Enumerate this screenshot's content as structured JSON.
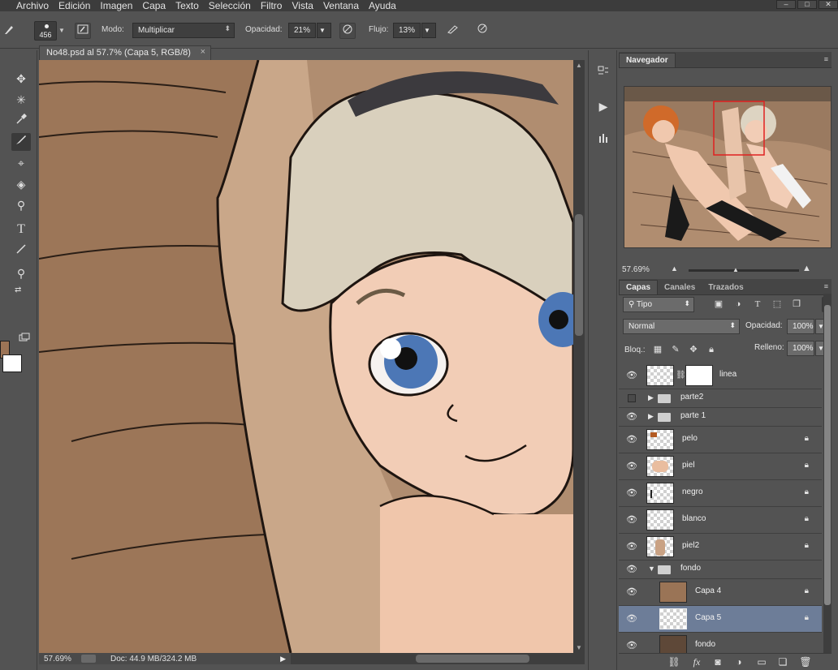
{
  "menubar": {
    "items": [
      "Archivo",
      "Edición",
      "Imagen",
      "Capa",
      "Texto",
      "Selección",
      "Filtro",
      "Vista",
      "Ventana",
      "Ayuda"
    ]
  },
  "options": {
    "brush_size": "456",
    "mode_label": "Modo:",
    "mode_value": "Multiplicar",
    "opacity_label": "Opacidad:",
    "opacity_value": "21%",
    "flow_label": "Flujo:",
    "flow_value": "13%"
  },
  "document": {
    "tab_title": "No48.psd al 57.7% (Capa 5, RGB/8)",
    "zoom": "57.69%",
    "doc_info": "Doc: 44.9 MB/324.2 MB"
  },
  "colors": {
    "foreground": "#9c7456",
    "background": "#ffffff",
    "selected_layer": "#6d7d98"
  },
  "navigator": {
    "title": "Navegador",
    "zoom": "57.69%"
  },
  "layers_panel": {
    "tabs": [
      "Capas",
      "Canales",
      "Trazados"
    ],
    "filter_value": "Tipo",
    "blend_mode": "Normal",
    "opacity_label": "Opacidad:",
    "opacity_value": "100%",
    "lock_label": "Bloq.:",
    "fill_label": "Relleno:",
    "fill_value": "100%",
    "layers": [
      {
        "name": "linea",
        "visible": true,
        "type": "layer-mask",
        "locked": false
      },
      {
        "name": "parte2",
        "visible": false,
        "type": "group",
        "locked": false
      },
      {
        "name": "parte 1",
        "visible": true,
        "type": "group",
        "locked": false
      },
      {
        "name": "pelo",
        "visible": true,
        "type": "layer",
        "locked": true
      },
      {
        "name": "piel",
        "visible": true,
        "type": "layer",
        "locked": true
      },
      {
        "name": "negro",
        "visible": true,
        "type": "layer",
        "locked": true
      },
      {
        "name": "blanco",
        "visible": true,
        "type": "layer",
        "locked": true
      },
      {
        "name": "piel2",
        "visible": true,
        "type": "layer",
        "locked": true
      },
      {
        "name": "fondo",
        "visible": true,
        "type": "group-open",
        "locked": false
      },
      {
        "name": "Capa 4",
        "visible": true,
        "type": "layer",
        "locked": true
      },
      {
        "name": "Capa 5",
        "visible": true,
        "type": "layer",
        "locked": true,
        "selected": true
      },
      {
        "name": "fondo",
        "visible": true,
        "type": "layer",
        "locked": false
      }
    ]
  },
  "icons": {
    "tools": [
      "move-icon",
      "magic-wand-icon",
      "eyedropper-icon",
      "brush-icon",
      "clone-stamp-icon",
      "paint-bucket-icon",
      "zoom-icon",
      "type-icon",
      "line-icon",
      "zoom-icon",
      "swap-colors-icon",
      "screen-mode-icon"
    ],
    "footer": [
      "link-icon",
      "fx-icon",
      "mask-icon",
      "adjustment-icon",
      "folder-icon",
      "new-layer-icon",
      "trash-icon"
    ]
  }
}
